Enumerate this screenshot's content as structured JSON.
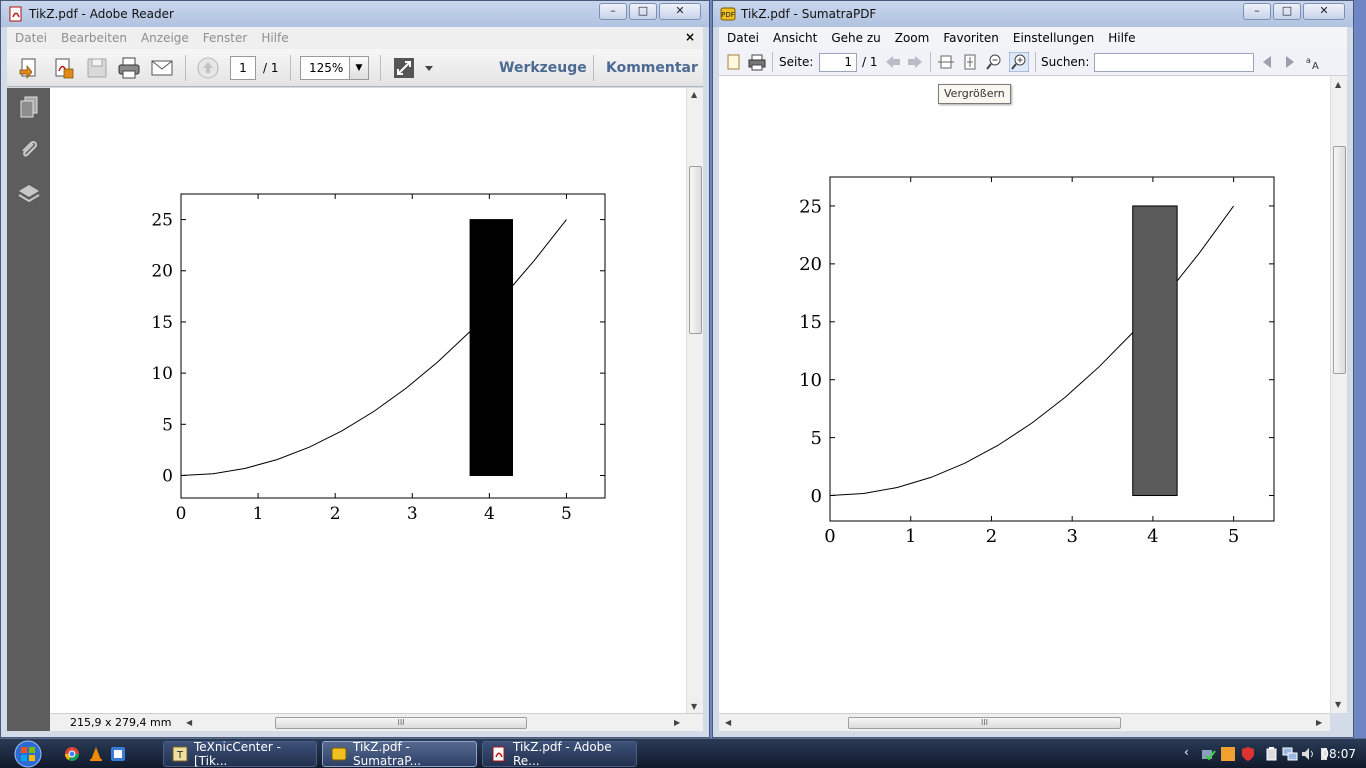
{
  "reader": {
    "title": "TikZ.pdf - Adobe Reader",
    "menu": [
      "Datei",
      "Bearbeiten",
      "Anzeige",
      "Fenster",
      "Hilfe"
    ],
    "close_doc": "×",
    "page_current": "1",
    "page_total": "/ 1",
    "zoom": "125%",
    "tools_link": "Werkzeuge",
    "comment_link": "Kommentar",
    "page_size": "215,9 x 279,4 mm",
    "scroll_glyph": "III"
  },
  "sumatra": {
    "title": "TikZ.pdf - SumatraPDF",
    "menu": [
      "Datei",
      "Ansicht",
      "Gehe zu",
      "Zoom",
      "Favoriten",
      "Einstellungen",
      "Hilfe"
    ],
    "page_label": "Seite:",
    "page_current": "1",
    "page_total": "/ 1",
    "search_label": "Suchen:",
    "search_value": "",
    "tooltip": "Vergrößern",
    "scroll_glyph": "III"
  },
  "window_buttons": {
    "minimize": "–",
    "maximize": "□",
    "close": "✕"
  },
  "chart_data": [
    {
      "type": "line",
      "title": "",
      "xlabel": "",
      "ylabel": "",
      "xticks": [
        0,
        1,
        2,
        3,
        4,
        5
      ],
      "yticks": [
        0,
        5,
        10,
        15,
        20,
        25
      ],
      "xlim": [
        0,
        5.5
      ],
      "ylim": [
        -2.2,
        27.5
      ],
      "grid": false,
      "series": [
        {
          "x": [
            0,
            0.417,
            0.833,
            1.25,
            1.667,
            2.083,
            2.5,
            2.917,
            3.333,
            3.75,
            4.167,
            4.583,
            5
          ],
          "y": [
            0,
            0.174,
            0.694,
            1.563,
            2.778,
            4.34,
            6.25,
            8.507,
            11.111,
            14.063,
            17.361,
            21.007,
            25
          ]
        }
      ],
      "bars": [
        {
          "x0": 3.75,
          "x1": 4.3,
          "y0": 0,
          "y1": 25,
          "color": "#000000"
        }
      ]
    },
    {
      "type": "line",
      "title": "",
      "xlabel": "",
      "ylabel": "",
      "xticks": [
        0,
        1,
        2,
        3,
        4,
        5
      ],
      "yticks": [
        0,
        5,
        10,
        15,
        20,
        25
      ],
      "xlim": [
        0,
        5.5
      ],
      "ylim": [
        -2.2,
        27.5
      ],
      "grid": false,
      "series": [
        {
          "x": [
            0,
            0.417,
            0.833,
            1.25,
            1.667,
            2.083,
            2.5,
            2.917,
            3.333,
            3.75,
            4.167,
            4.583,
            5
          ],
          "y": [
            0,
            0.174,
            0.694,
            1.563,
            2.778,
            4.34,
            6.25,
            8.507,
            11.111,
            14.063,
            17.361,
            21.007,
            25
          ]
        }
      ],
      "bars": [
        {
          "x0": 3.75,
          "x1": 4.3,
          "y0": 0,
          "y1": 25,
          "color": "#5a5a5a"
        }
      ]
    }
  ],
  "taskbar": {
    "tasks": [
      "TeXnicCenter - [Tik...",
      "TikZ.pdf - SumatraP...",
      "TikZ.pdf - Adobe Re..."
    ],
    "clock": "08:07"
  }
}
